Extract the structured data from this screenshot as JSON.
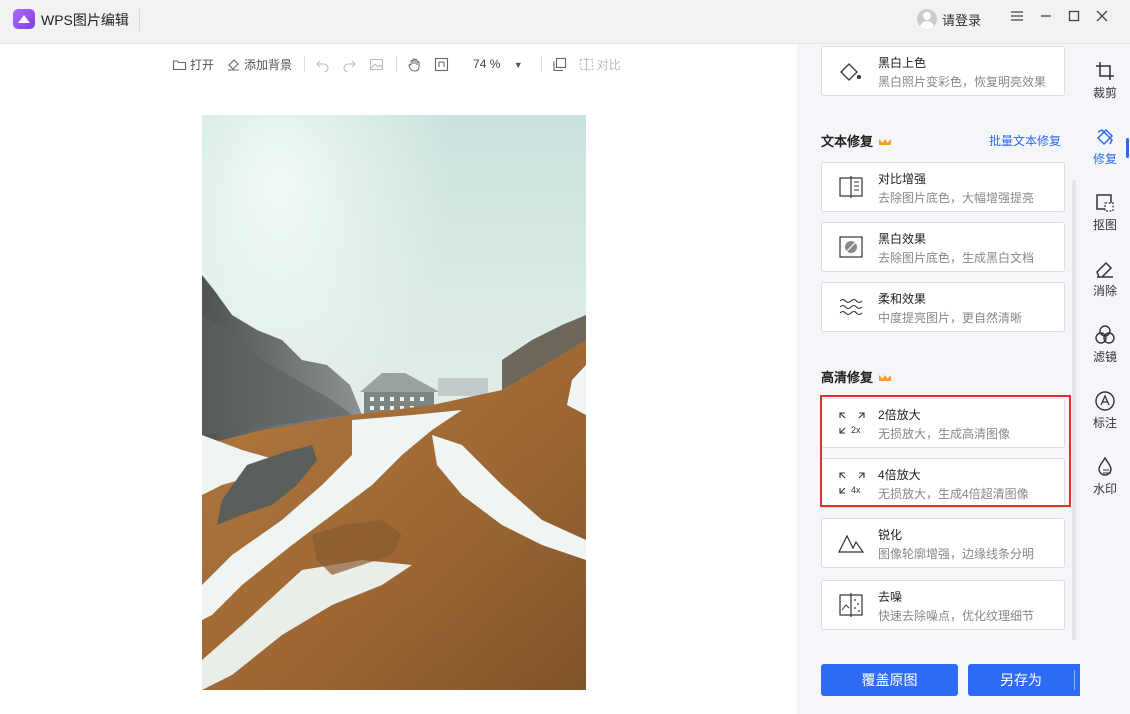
{
  "app": {
    "title": "WPS图片编辑",
    "login": "请登录"
  },
  "window": {
    "menu_icon": "hamburger-icon",
    "minimize_icon": "minimize-icon",
    "maximize_icon": "maximize-icon",
    "close_icon": "close-icon"
  },
  "toolbar": {
    "open": "打开",
    "add_background": "添加背景",
    "zoom": "74 %",
    "compare": "对比"
  },
  "panel": {
    "top_card": {
      "name": "黑白上色",
      "desc": "黑白照片变彩色，恢复明亮效果"
    },
    "text_repair": {
      "title": "文本修复",
      "batch_link": "批量文本修复",
      "cards": [
        {
          "name": "对比增强",
          "desc": "去除图片底色，大幅增强提亮"
        },
        {
          "name": "黑白效果",
          "desc": "去除图片底色，生成黑白文档"
        },
        {
          "name": "柔和效果",
          "desc": "中度提亮图片，更自然清晰"
        }
      ]
    },
    "hd_repair": {
      "title": "高清修复",
      "cards": [
        {
          "name": "2倍放大",
          "desc": "无损放大，生成高清图像",
          "badge": "2x"
        },
        {
          "name": "4倍放大",
          "desc": "无损放大，生成4倍超清图像",
          "badge": "4x"
        },
        {
          "name": "锐化",
          "desc": "图像轮廓增强，边缘线条分明"
        },
        {
          "name": "去噪",
          "desc": "快速去除噪点，优化纹理细节"
        }
      ]
    },
    "buttons": {
      "cover": "覆盖原图",
      "save_as": "另存为"
    }
  },
  "rail": {
    "items": [
      {
        "label": "裁剪",
        "icon": "crop-icon"
      },
      {
        "label": "修复",
        "icon": "repair-icon"
      },
      {
        "label": "抠图",
        "icon": "cutout-icon"
      },
      {
        "label": "消除",
        "icon": "eraser-icon"
      },
      {
        "label": "滤镜",
        "icon": "filter-icon"
      },
      {
        "label": "标注",
        "icon": "annotate-icon"
      },
      {
        "label": "水印",
        "icon": "watermark-icon"
      }
    ],
    "active": "修复"
  },
  "colors": {
    "accent": "#2f6cf5",
    "highlight": "#e0312f",
    "crown": "#f2a02b"
  }
}
